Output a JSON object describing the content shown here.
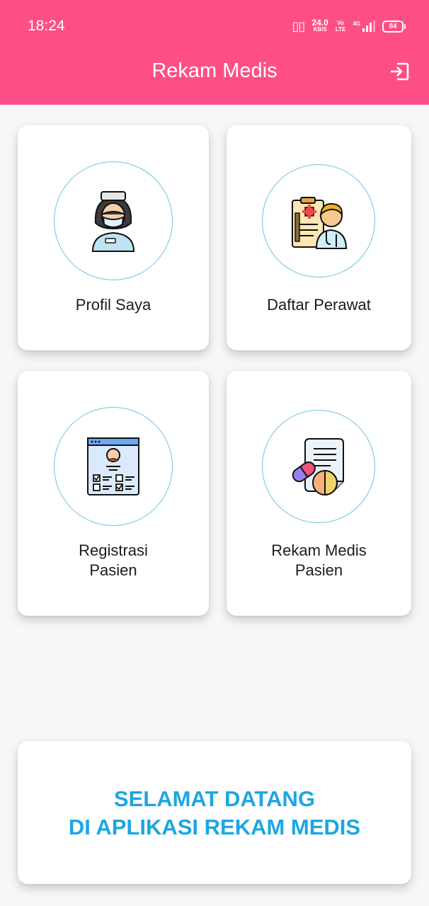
{
  "status_bar": {
    "time": "18:24",
    "speed_value": "24.0",
    "speed_unit": "KB/S",
    "volte_top": "Vo",
    "volte_bottom": "LTE",
    "network": "4G",
    "battery": "84"
  },
  "app_bar": {
    "title": "Rekam Medis",
    "logout_icon": "logout-icon",
    "background": "#fd4f86"
  },
  "menu": {
    "profil": {
      "label": "Profil Saya",
      "icon": "nurse-icon"
    },
    "daftar": {
      "label": "Daftar Perawat",
      "icon": "doctor-chart-icon"
    },
    "registrasi": {
      "label_line1": "Registrasi",
      "label_line2": "Pasien",
      "icon": "registration-form-icon"
    },
    "rekam": {
      "label_line1": "Rekam Medis",
      "label_line2": "Pasien",
      "icon": "medicine-record-icon"
    }
  },
  "welcome": {
    "line1": "SELAMAT DATANG",
    "line2": "DI APLIKASI REKAM MEDIS",
    "color": "#1da6e2"
  }
}
